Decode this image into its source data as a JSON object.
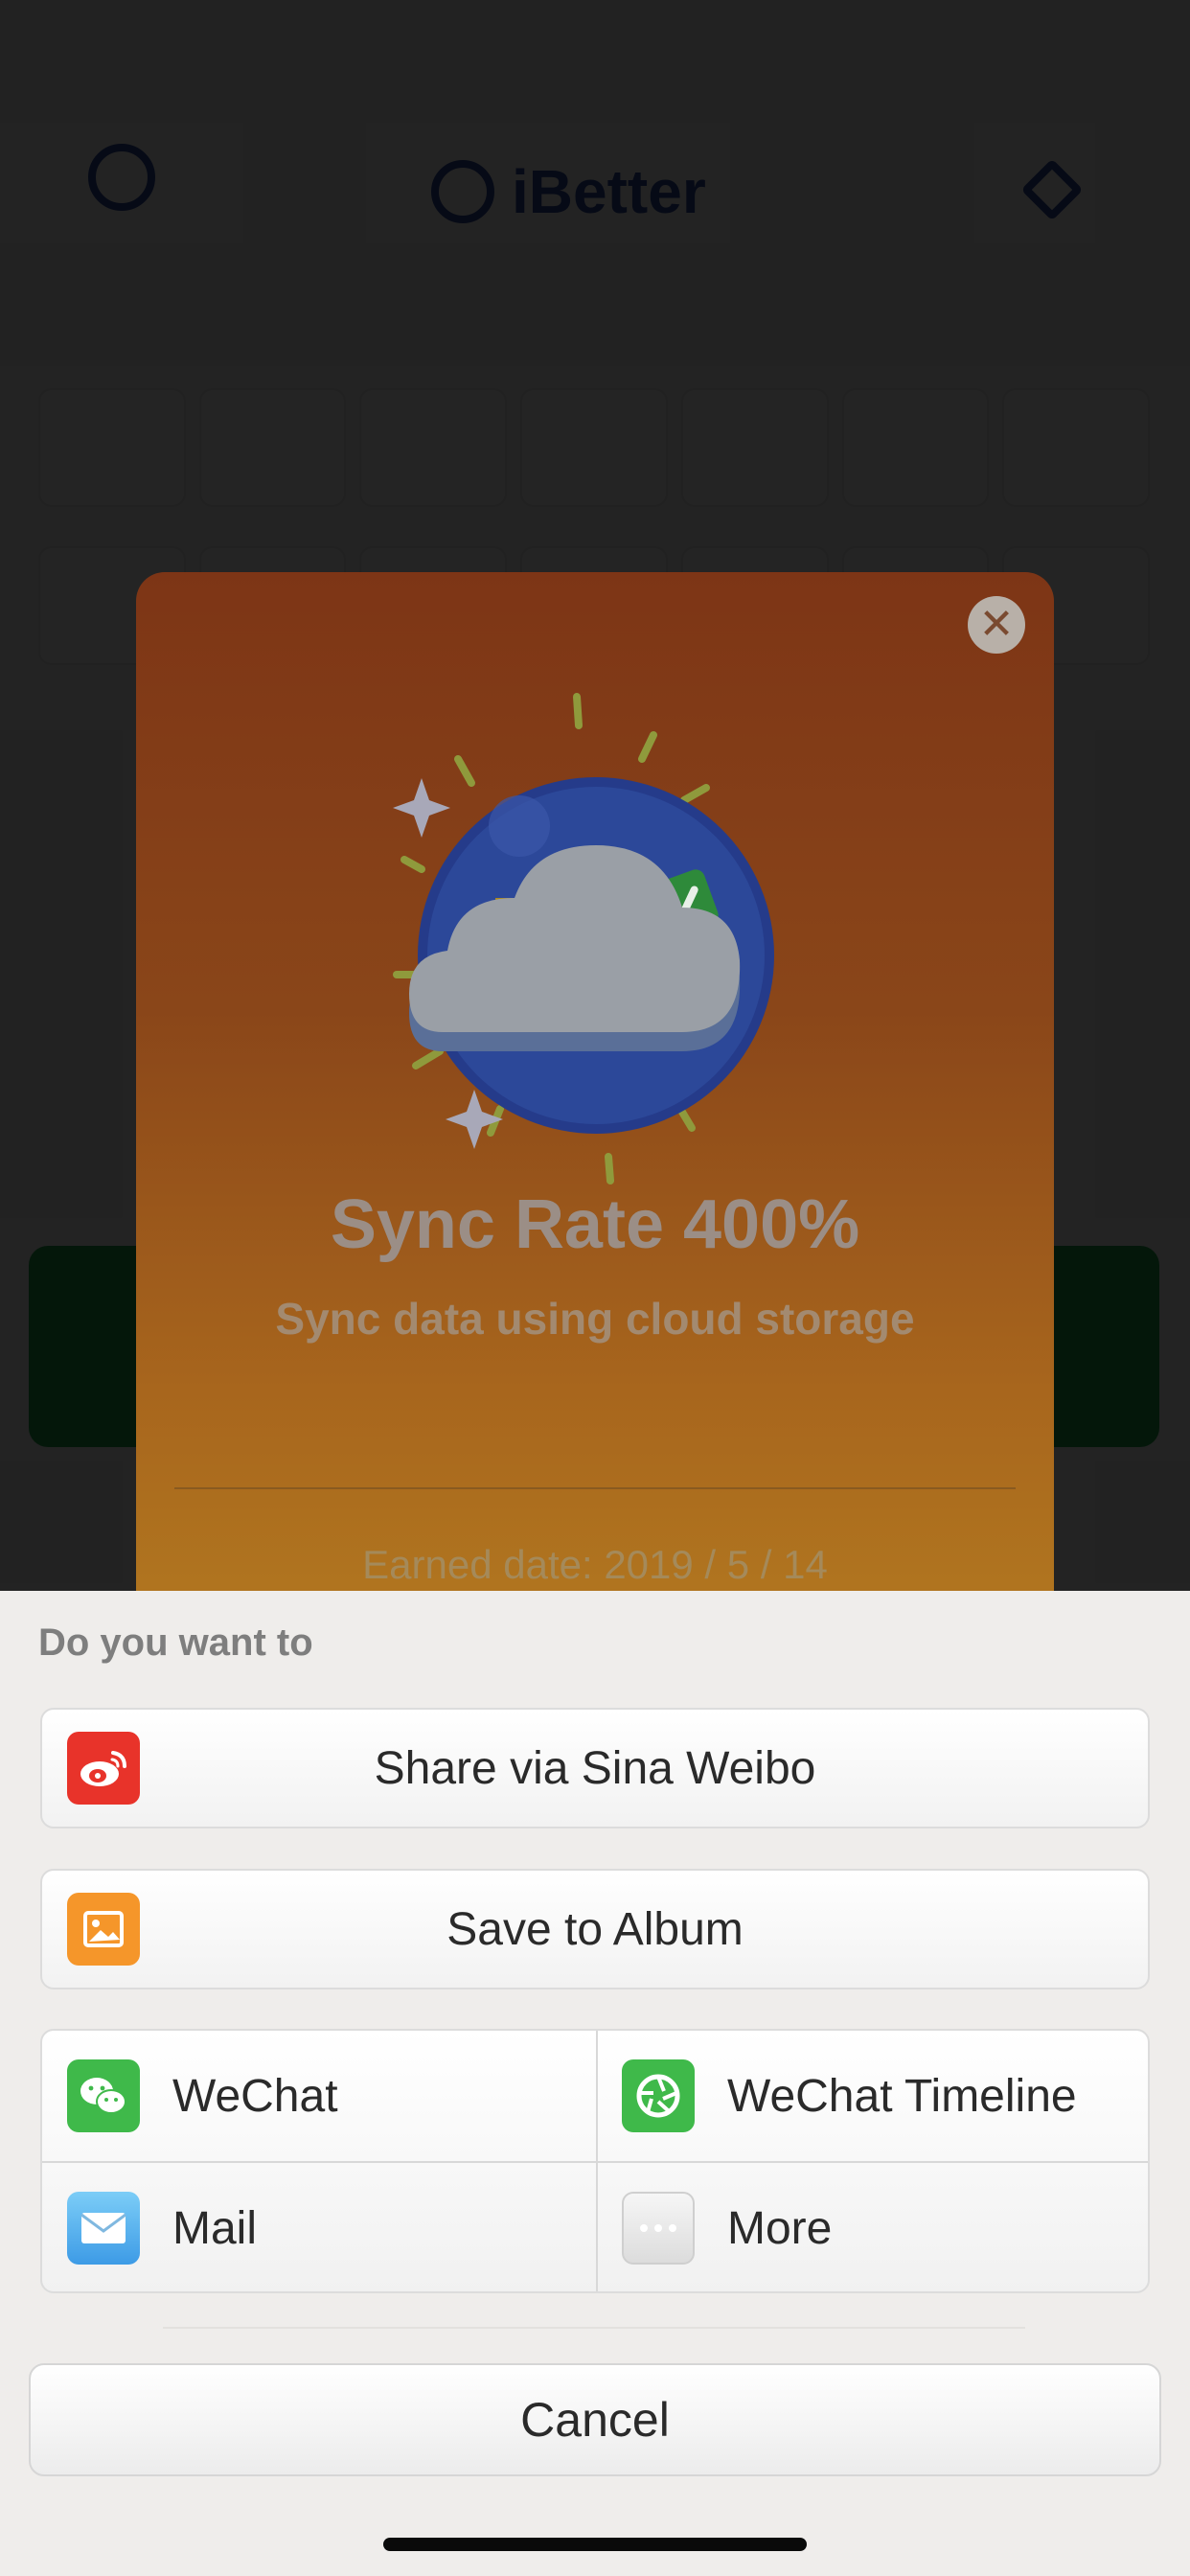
{
  "background_app": {
    "title": "iBetter"
  },
  "achievement": {
    "title": "Sync Rate 400%",
    "subtitle": "Sync data using cloud storage",
    "earned_date": "Earned date: 2019 / 5 / 14",
    "close_glyph": "✕",
    "badge_icon": "cloud-trophy-badge-icon"
  },
  "share_sheet": {
    "prompt": "Do you want to",
    "actions": [
      {
        "label": "Share via Sina Weibo",
        "icon": "weibo-icon",
        "color": "#e8332a"
      },
      {
        "label": "Save to Album",
        "icon": "album-icon",
        "color": "#f5962a"
      }
    ],
    "grid": [
      {
        "label": "WeChat",
        "icon": "wechat-icon",
        "color": "#3fb94a"
      },
      {
        "label": "WeChat Timeline",
        "icon": "wechat-timeline-icon",
        "color": "#3fb94a"
      },
      {
        "label": "Mail",
        "icon": "mail-icon",
        "color": "#5db6f0"
      },
      {
        "label": "More",
        "icon": "more-icon",
        "color": "#e0e0e0"
      }
    ],
    "cancel_label": "Cancel"
  }
}
